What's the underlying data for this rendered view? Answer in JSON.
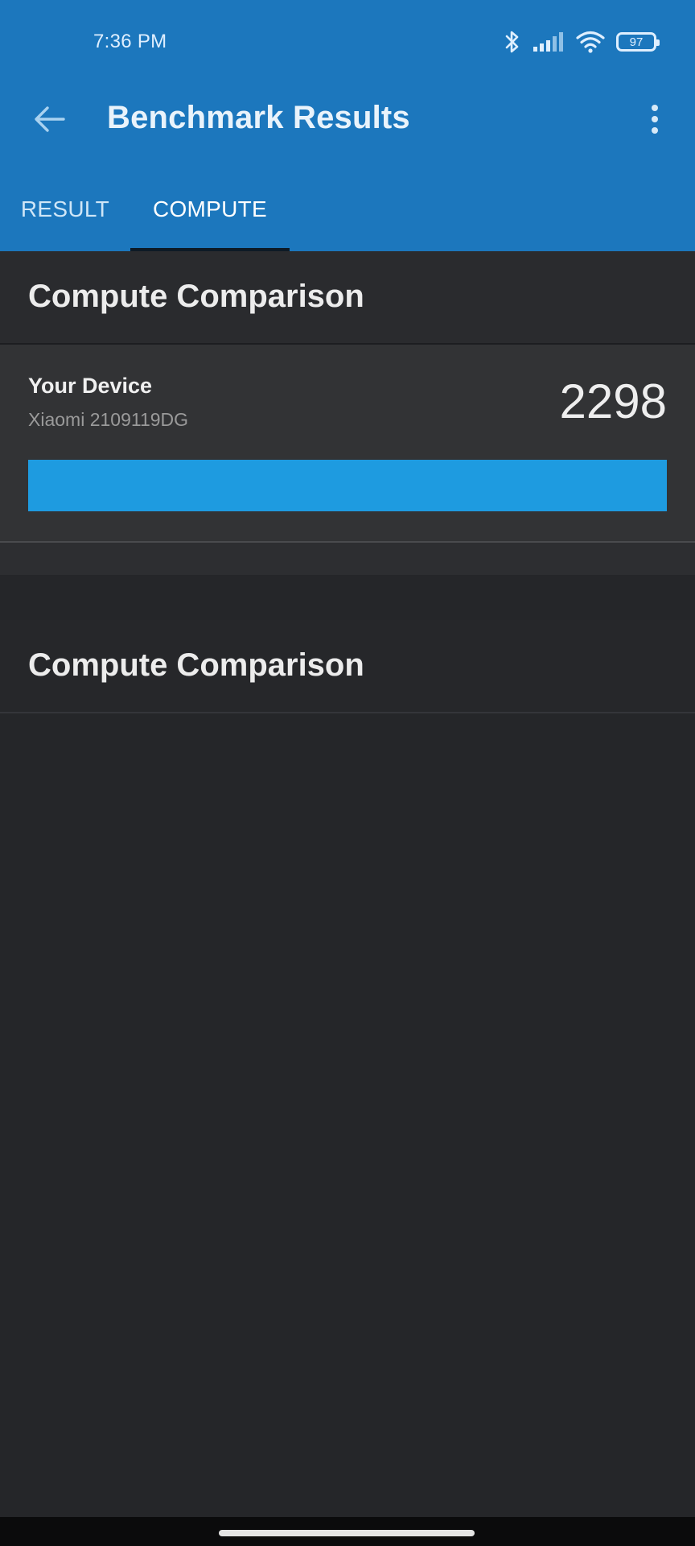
{
  "status_bar": {
    "time": "7:36 PM",
    "battery": "97",
    "icons": [
      "bluetooth-icon",
      "cellular-signal-icon",
      "wifi-icon",
      "battery-icon"
    ]
  },
  "toolbar": {
    "title": "Benchmark Results",
    "back_icon": "arrow-left-icon",
    "menu_icon": "more-vertical-icon"
  },
  "tabs": [
    {
      "label": "RESULT",
      "selected": false
    },
    {
      "label": "COMPUTE",
      "selected": true
    }
  ],
  "sections": [
    {
      "title": "Compute Comparison"
    },
    {
      "title": "Compute Comparison"
    }
  ],
  "device": {
    "label": "Your Device",
    "model": "Xiaomi 2109119DG",
    "score": "2298",
    "bar_fraction": 1.0
  },
  "colors": {
    "app_bar": "#1c77bd",
    "background": "#252629",
    "card": "#323335",
    "bar": "#1e9be0"
  }
}
